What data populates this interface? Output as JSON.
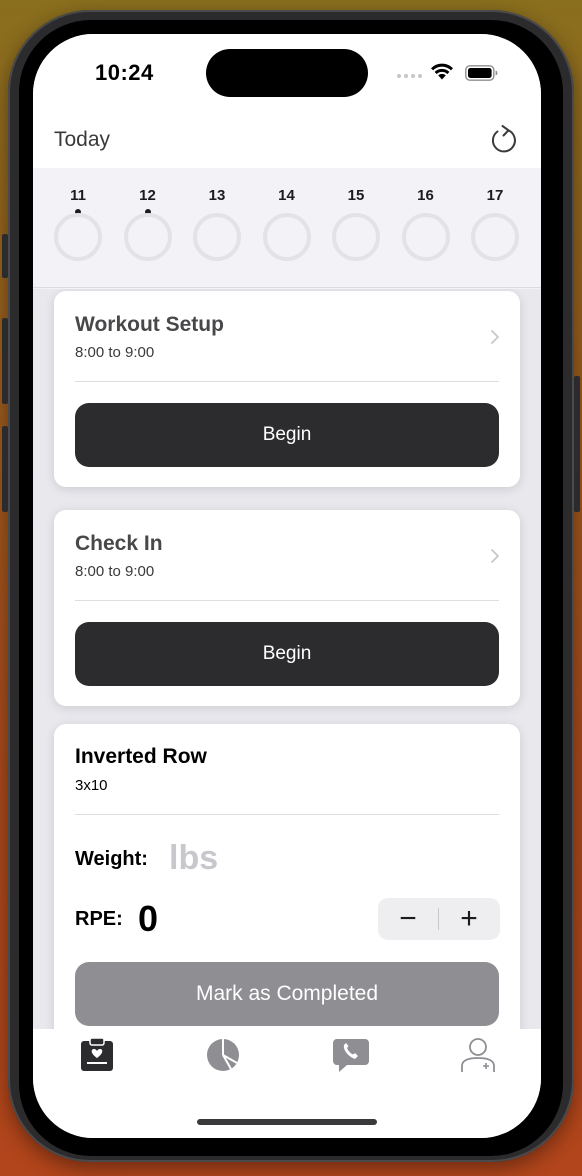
{
  "status_bar": {
    "time": "10:24"
  },
  "header": {
    "title": "Today"
  },
  "week": {
    "days": [
      {
        "num": "11",
        "has_dot": true
      },
      {
        "num": "12",
        "has_dot": true
      },
      {
        "num": "13",
        "has_dot": false
      },
      {
        "num": "14",
        "has_dot": false
      },
      {
        "num": "15",
        "has_dot": false
      },
      {
        "num": "16",
        "has_dot": false
      },
      {
        "num": "17",
        "has_dot": false
      }
    ]
  },
  "cards": {
    "workout_setup": {
      "title": "Workout Setup",
      "time": "8:00 to 9:00",
      "button": "Begin"
    },
    "check_in": {
      "title": "Check In",
      "time": "8:00 to 9:00",
      "button": "Begin"
    },
    "exercise": {
      "title": "Inverted Row",
      "sets": "3x10",
      "weight_label": "Weight:",
      "weight_unit": "lbs",
      "rpe_label": "RPE:",
      "rpe_value": "0",
      "minus": "−",
      "plus": "+",
      "complete_button": "Mark as Completed"
    }
  },
  "tabbar": {
    "icons": [
      "care-plan-icon",
      "insights-pie-icon",
      "contact-chat-icon",
      "profile-icon"
    ],
    "active_color": "#2c2c2e",
    "inactive_color": "#8e8e93"
  }
}
